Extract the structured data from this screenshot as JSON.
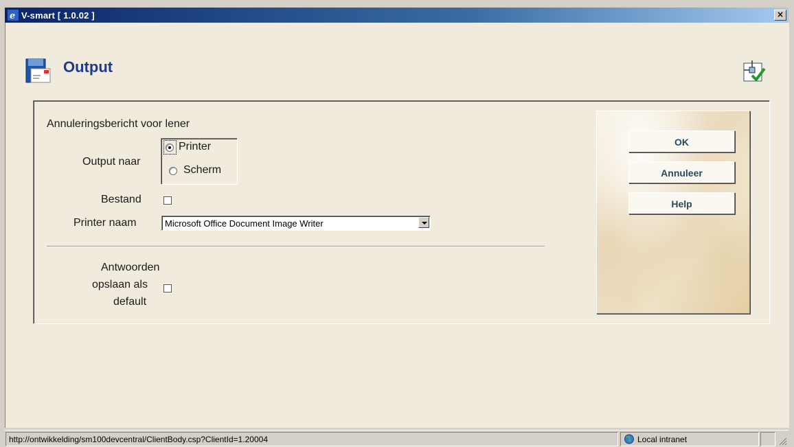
{
  "window": {
    "title": "V-smart [ 1.0.02 ]",
    "close_symbol": "×"
  },
  "page": {
    "title": "Output"
  },
  "form": {
    "heading": "Annuleringsbericht voor lener",
    "output_label": "Output naar",
    "output_options": [
      {
        "label": "Printer",
        "selected": true
      },
      {
        "label": "Scherm",
        "selected": false
      }
    ],
    "file_label": "Bestand",
    "file_checked": false,
    "printer_label": "Printer naam",
    "printer_value": "Microsoft Office Document Image Writer",
    "save_label_lines": [
      "Antwoorden",
      "opslaan als",
      "default"
    ],
    "save_checked": false
  },
  "buttons": {
    "ok": "OK",
    "cancel": "Annuleer",
    "help": "Help"
  },
  "statusbar": {
    "url": "http://ontwikkelding/sm100devcentral/ClientBody.csp?ClientId=1.20004",
    "zone": "Local intranet"
  },
  "colors": {
    "title_blue": "#1f3a8a",
    "button_text": "#29495a",
    "titlebar_start": "#0a246a"
  },
  "icons": [
    "ie-icon",
    "output-document-icon",
    "wizard-check-icon",
    "globe-icon"
  ]
}
